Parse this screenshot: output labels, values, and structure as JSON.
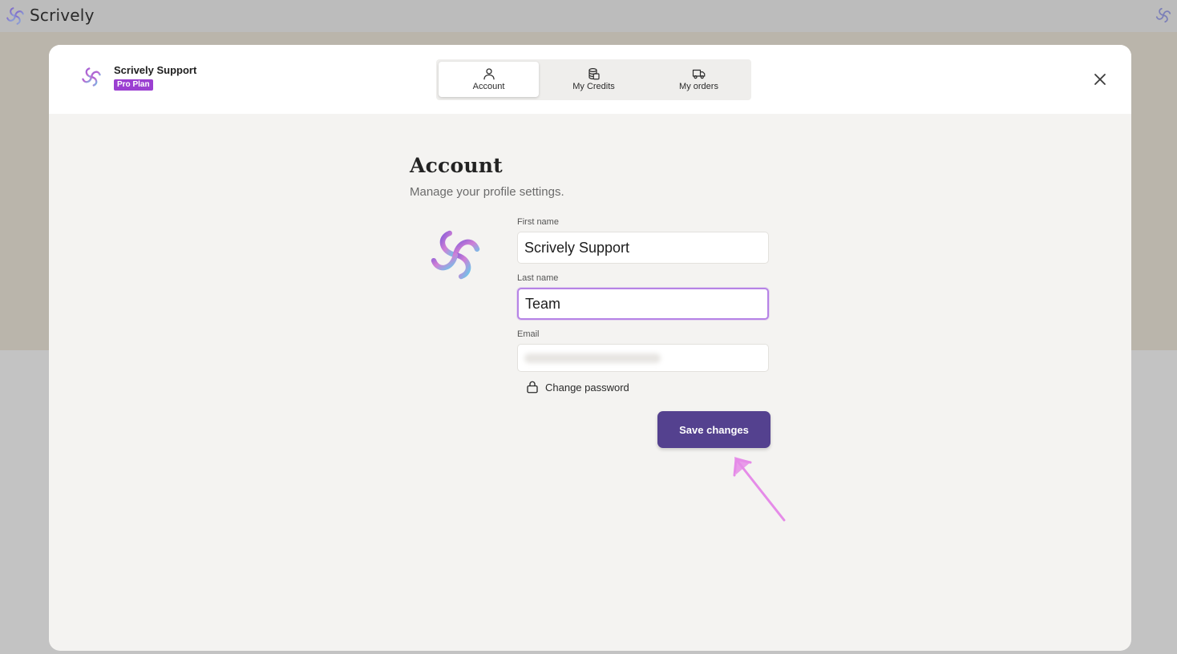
{
  "app": {
    "brand": "Scrively",
    "logo_icon": "scrively-logo-icon"
  },
  "modal": {
    "user": {
      "name": "Scrively Support",
      "plan": "Pro Plan"
    },
    "tabs": [
      {
        "label": "Account",
        "icon": "user-icon",
        "active": true
      },
      {
        "label": "My Credits",
        "icon": "credits-stack-icon",
        "active": false
      },
      {
        "label": "My orders",
        "icon": "truck-icon",
        "active": false
      }
    ],
    "close_icon": "close-icon"
  },
  "account": {
    "title": "Account",
    "subtitle": "Manage your profile settings.",
    "first_name": {
      "label": "First name",
      "value": "Scrively Support"
    },
    "last_name": {
      "label": "Last name",
      "value": "Team"
    },
    "email": {
      "label": "Email",
      "value": ""
    },
    "change_password_label": "Change password",
    "save_label": "Save changes"
  },
  "colors": {
    "accent": "#54418f",
    "badge": "#9b3fd1",
    "focus_ring": "#b683e6",
    "annotation": "#e58be8"
  }
}
